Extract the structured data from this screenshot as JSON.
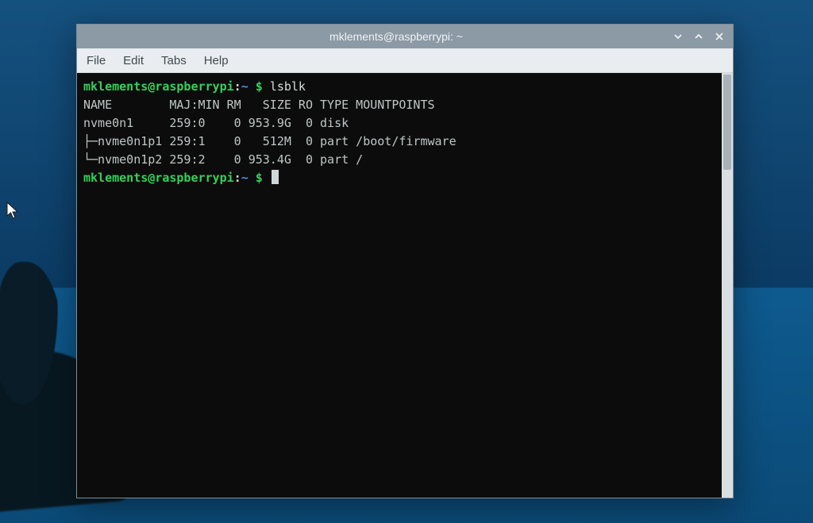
{
  "window": {
    "title": "mklements@raspberrypi: ~"
  },
  "menu": {
    "file": "File",
    "edit": "Edit",
    "tabs": "Tabs",
    "help": "Help"
  },
  "prompt": {
    "user_host": "mklements@raspberrypi",
    "separator": ":",
    "path": "~",
    "symbol": "$"
  },
  "terminal": {
    "command1": "lsblk",
    "header": "NAME        MAJ:MIN RM   SIZE RO TYPE MOUNTPOINTS",
    "row_disk": "nvme0n1     259:0    0 953.9G  0 disk ",
    "row_p1": "├─nvme0n1p1 259:1    0   512M  0 part /boot/firmware",
    "row_p2": "└─nvme0n1p2 259:2    0 953.4G  0 part /"
  },
  "lsblk_data": {
    "columns": [
      "NAME",
      "MAJ:MIN",
      "RM",
      "SIZE",
      "RO",
      "TYPE",
      "MOUNTPOINTS"
    ],
    "rows": [
      {
        "NAME": "nvme0n1",
        "MAJ:MIN": "259:0",
        "RM": "0",
        "SIZE": "953.9G",
        "RO": "0",
        "TYPE": "disk",
        "MOUNTPOINTS": ""
      },
      {
        "NAME": "nvme0n1p1",
        "MAJ:MIN": "259:1",
        "RM": "0",
        "SIZE": "512M",
        "RO": "0",
        "TYPE": "part",
        "MOUNTPOINTS": "/boot/firmware"
      },
      {
        "NAME": "nvme0n1p2",
        "MAJ:MIN": "259:2",
        "RM": "0",
        "SIZE": "953.4G",
        "RO": "0",
        "TYPE": "part",
        "MOUNTPOINTS": "/"
      }
    ]
  }
}
